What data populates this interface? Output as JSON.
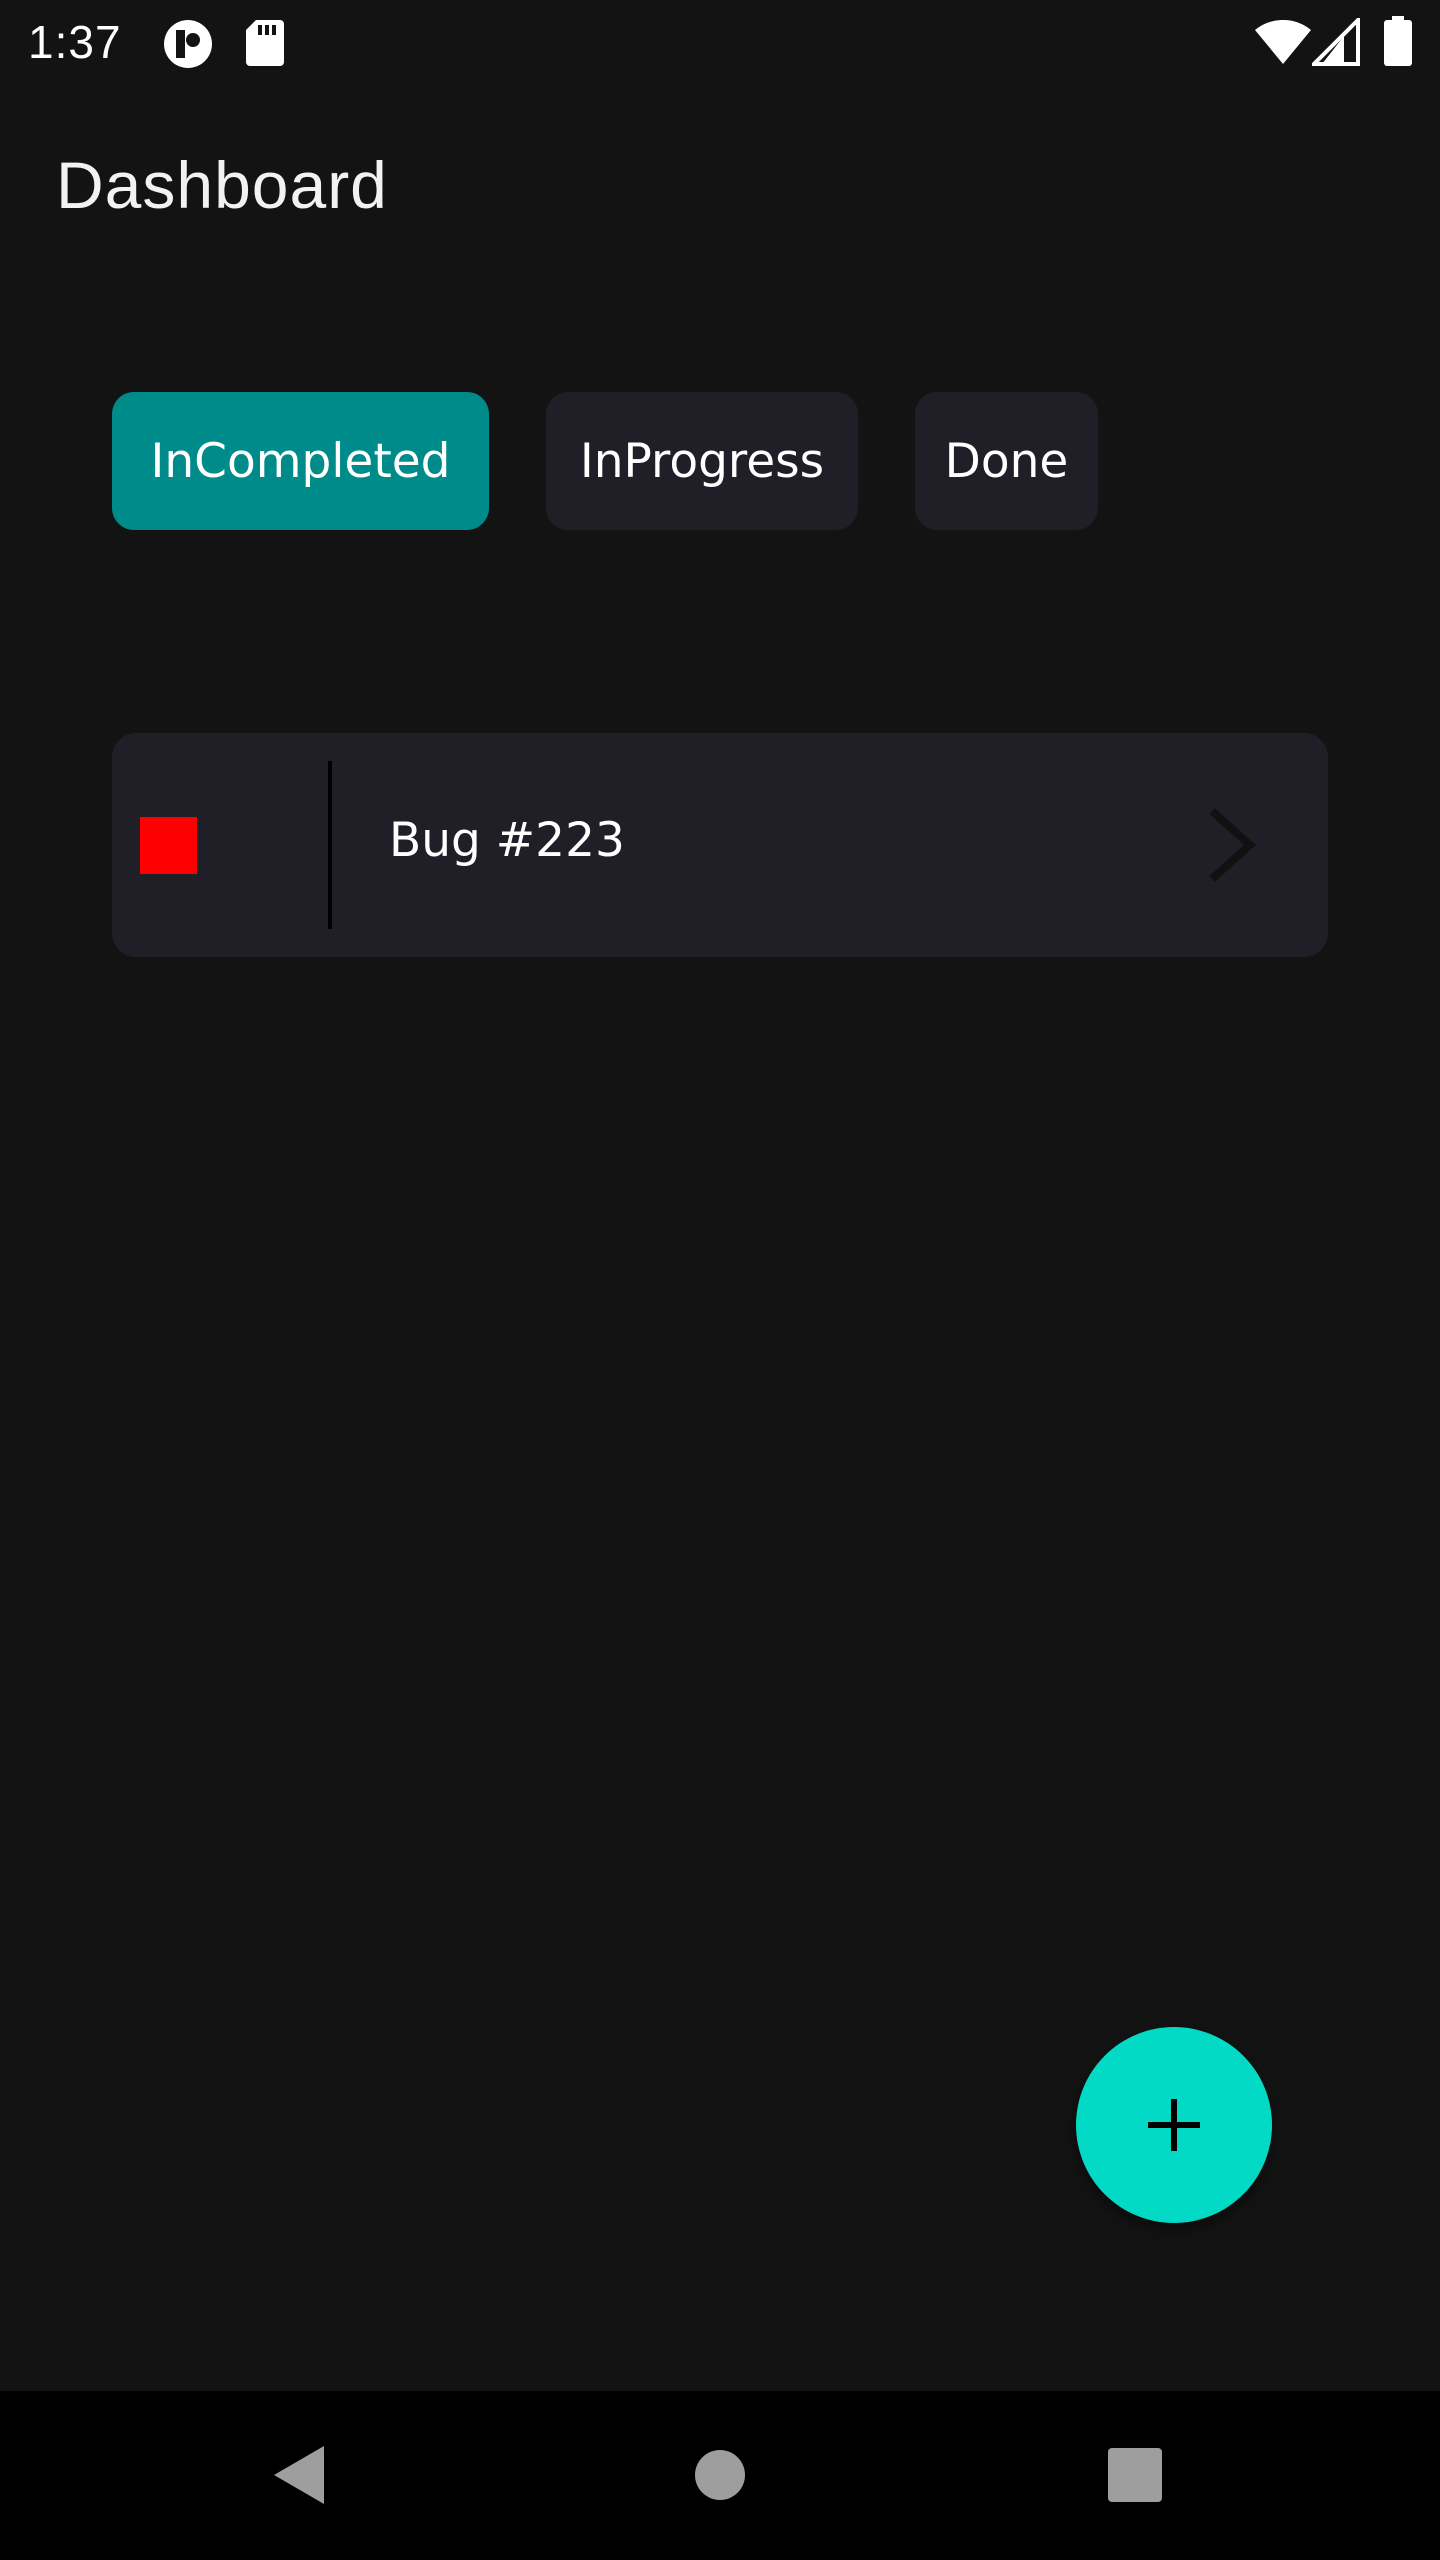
{
  "status_bar": {
    "time": "1:37",
    "icons": [
      "notification-app-icon",
      "sd-card-icon",
      "wifi-icon",
      "signal-icon",
      "battery-icon"
    ]
  },
  "header": {
    "title": "Dashboard"
  },
  "filters": {
    "chips": [
      {
        "label": "InCompleted",
        "selected": true
      },
      {
        "label": "InProgress",
        "selected": false
      },
      {
        "label": "Done",
        "selected": false
      }
    ]
  },
  "tasks": [
    {
      "title": "Bug #223",
      "priority_color": "#ff0000"
    }
  ],
  "fab": {
    "icon": "plus-icon"
  },
  "nav_bar": {
    "buttons": [
      "back-icon",
      "home-icon",
      "recents-icon"
    ]
  },
  "colors": {
    "background": "#131313",
    "surface": "#201f27",
    "accent": "#008b8b",
    "fab": "#03dac5"
  }
}
